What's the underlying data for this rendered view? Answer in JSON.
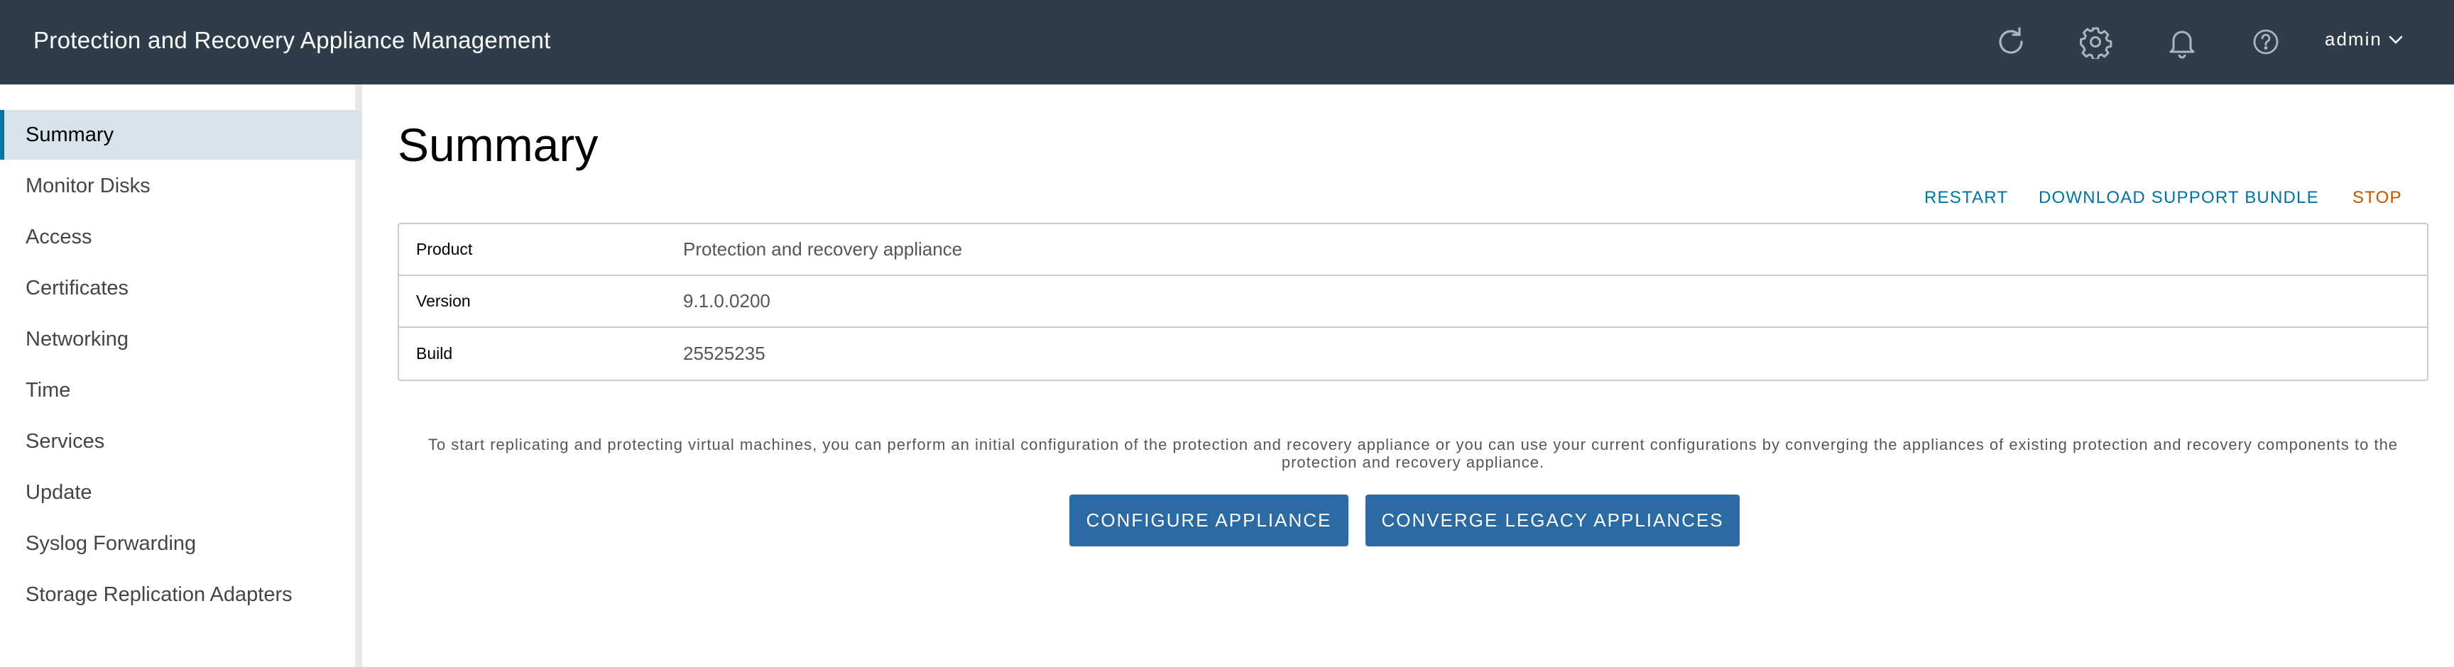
{
  "header": {
    "title": "Protection and Recovery Appliance Management",
    "icons": [
      "refresh-icon",
      "gear-icon",
      "bell-icon",
      "help-icon"
    ],
    "user": "admin",
    "background": "#2f3d4a"
  },
  "sidebar": {
    "items": [
      {
        "label": "Summary",
        "active": true
      },
      {
        "label": "Monitor Disks"
      },
      {
        "label": "Access"
      },
      {
        "label": "Certificates"
      },
      {
        "label": "Networking"
      },
      {
        "label": "Time"
      },
      {
        "label": "Services"
      },
      {
        "label": "Update"
      },
      {
        "label": "Syslog Forwarding"
      },
      {
        "label": "Storage Replication Adapters"
      }
    ],
    "active_color": "#d8e3e9",
    "accent_color": "#0072a3"
  },
  "main": {
    "title": "Summary",
    "actions": {
      "restart": "RESTART",
      "download_support_bundle": "DOWNLOAD SUPPORT BUNDLE",
      "stop": "STOP"
    },
    "info": [
      {
        "key": "Product",
        "value": "Protection and recovery appliance"
      },
      {
        "key": "Version",
        "value": "9.1.0.0200"
      },
      {
        "key": "Build",
        "value": "25525235"
      }
    ],
    "intro_text": "To start replicating and protecting virtual machines, you can perform an initial configuration of the protection and recovery appliance or you can use your current configurations by converging the appliances of existing protection and recovery components to the protection and recovery appliance.",
    "buttons": {
      "configure": "CONFIGURE APPLIANCE",
      "converge": "CONVERGE LEGACY APPLIANCES"
    },
    "link_color": "#0072a3",
    "stop_color": "#c25400",
    "button_color": "#2b6aa3"
  }
}
